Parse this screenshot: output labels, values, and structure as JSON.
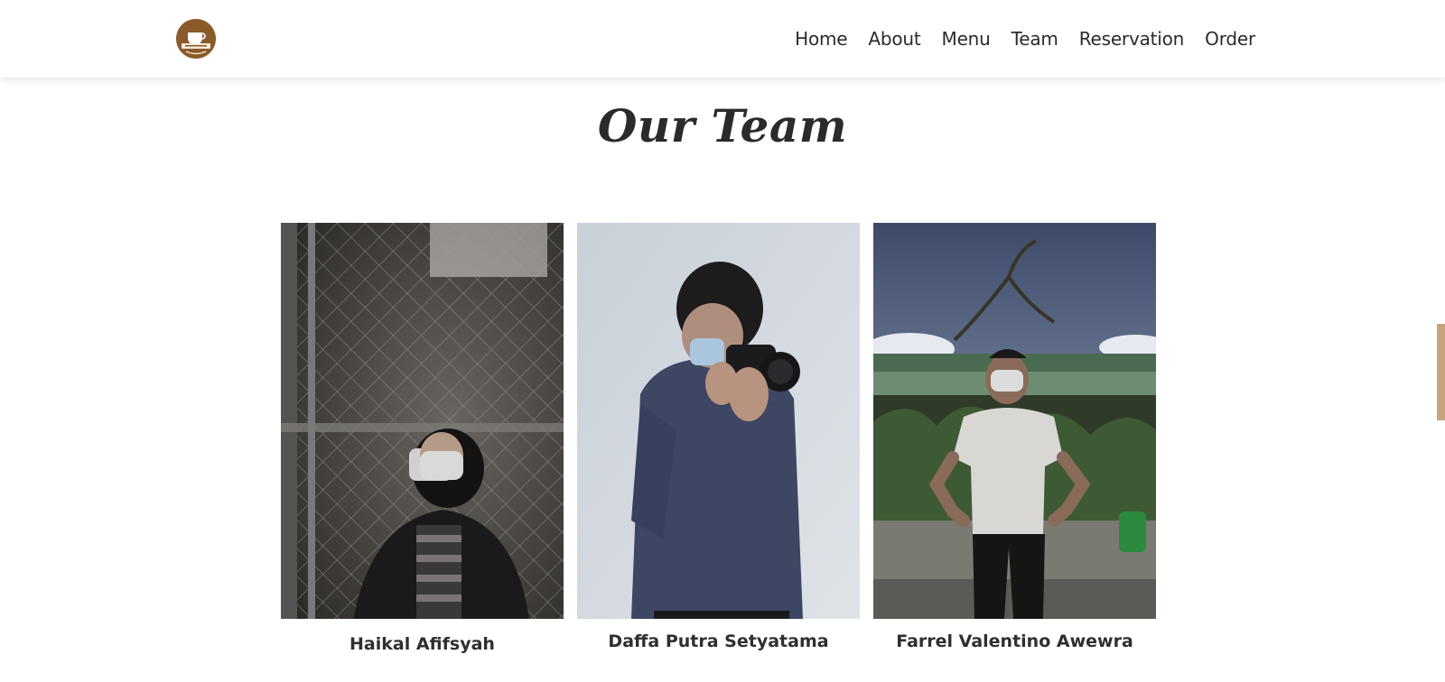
{
  "nav": {
    "logo_label": "coffee shop logo",
    "links": [
      "Home",
      "About",
      "Menu",
      "Team",
      "Reservation",
      "Order"
    ]
  },
  "section": {
    "title": "Our Team"
  },
  "team": [
    {
      "name": "Haikal Afifsyah"
    },
    {
      "name": "Daffa Putra Setyatama"
    },
    {
      "name": "Farrel Valentino Awewra"
    }
  ],
  "colors": {
    "brand_brown": "#8a5a2b",
    "accent_tab": "#c8a47e",
    "text_dark": "#2b2b2b"
  }
}
